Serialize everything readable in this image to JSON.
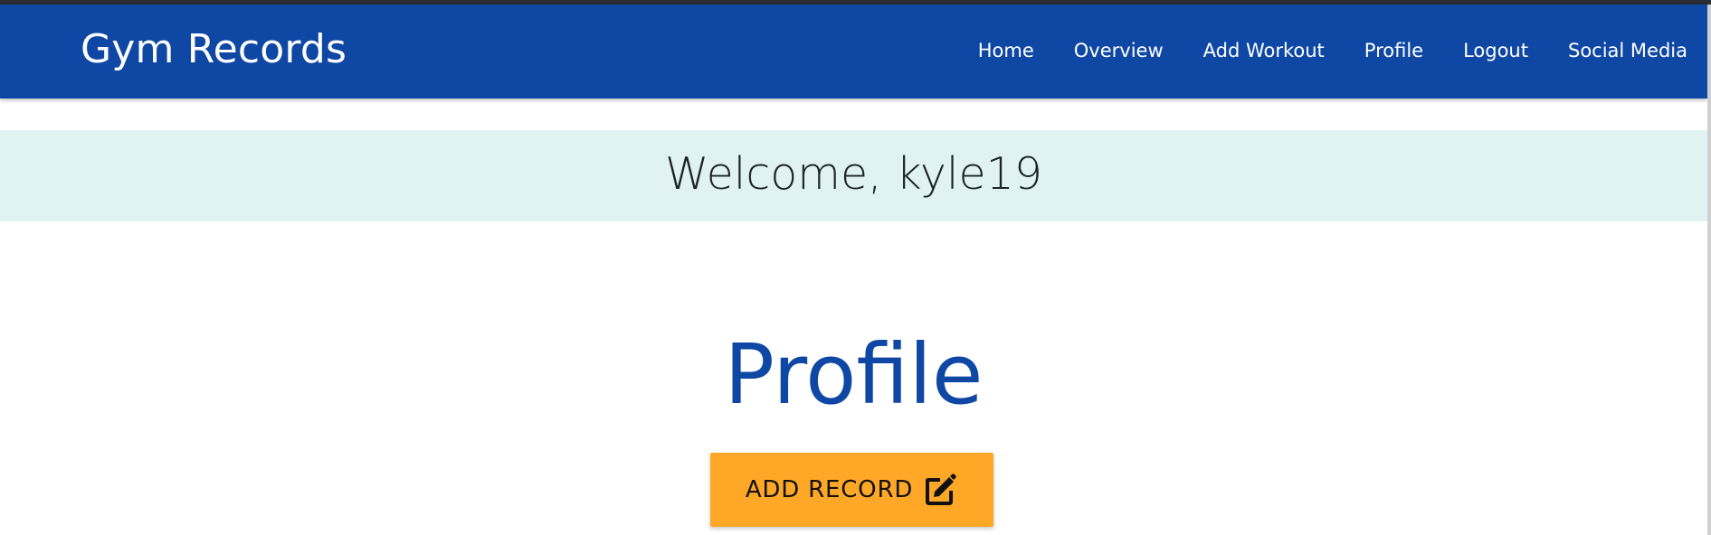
{
  "navbar": {
    "brand": "Gym Records",
    "links": [
      {
        "label": "Home"
      },
      {
        "label": "Overview"
      },
      {
        "label": "Add Workout"
      },
      {
        "label": "Profile"
      },
      {
        "label": "Logout"
      },
      {
        "label": "Social Media"
      }
    ]
  },
  "welcome": {
    "text": "Welcome, kyle19"
  },
  "main": {
    "title": "Profile",
    "add_record_button": {
      "label": "ADD RECORD",
      "icon": "edit-icon"
    }
  },
  "colors": {
    "navbar": "#0f48a4",
    "welcome_band": "#e0f2f1",
    "title": "#0f48a4",
    "button": "#ffa726"
  }
}
